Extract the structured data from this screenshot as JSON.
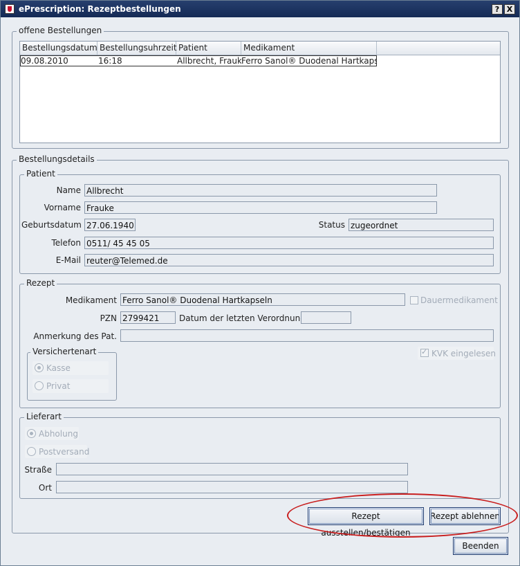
{
  "window": {
    "title": "ePrescription: Rezeptbestellungen",
    "help_btn": "?",
    "close_btn": "X",
    "icon": "app-shield-icon"
  },
  "open_orders": {
    "group_title": "offene Bestellungen",
    "columns": [
      "Bestellungsdatum",
      "Bestellungsuhrzeit",
      "Patient",
      "Medikament"
    ],
    "rows": [
      [
        "09.08.2010",
        "16:18",
        "Allbrecht, Frauke",
        "Ferro Sanol® Duodenal Hartkapseln"
      ]
    ]
  },
  "details": {
    "group_title": "Bestellungsdetails",
    "patient": {
      "group_title": "Patient",
      "name_label": "Name",
      "name": "Allbrecht",
      "vorname_label": "Vorname",
      "vorname": "Frauke",
      "geburtsdatum_label": "Geburtsdatum",
      "geburtsdatum": "27.06.1940",
      "status_label": "Status",
      "status": "zugeordnet",
      "telefon_label": "Telefon",
      "telefon": "0511/ 45 45 05",
      "email_label": "E-Mail",
      "email": "reuter@Telemed.de"
    },
    "rezept": {
      "group_title": "Rezept",
      "medikament_label": "Medikament",
      "medikament": "Ferro Sanol® Duodenal Hartkapseln",
      "dauermedikament_label": "Dauermedikament",
      "dauermedikament_checked": false,
      "pzn_label": "PZN",
      "pzn": "2799421",
      "letzte_verordnung_label": "Datum der letzten Verordnung",
      "letzte_verordnung": "",
      "anmerkung_label": "Anmerkung des Pat.",
      "anmerkung": "",
      "versichertenart_title": "Versichertenart",
      "kasse_label": "Kasse",
      "privat_label": "Privat",
      "selected": "Kasse",
      "kvk_label": "KVK eingelesen",
      "kvk_checked": true
    },
    "lieferart": {
      "group_title": "Lieferart",
      "abholung_label": "Abholung",
      "postversand_label": "Postversand",
      "selected": "Abholung",
      "strasse_label": "Straße",
      "strasse": "",
      "ort_label": "Ort",
      "ort": ""
    }
  },
  "buttons": {
    "ausstellen": "Rezept ausstellen/bestätigen",
    "ablehnen": "Rezept ablehnen",
    "beenden": "Beenden"
  },
  "annotation_color": "#c81e1e"
}
